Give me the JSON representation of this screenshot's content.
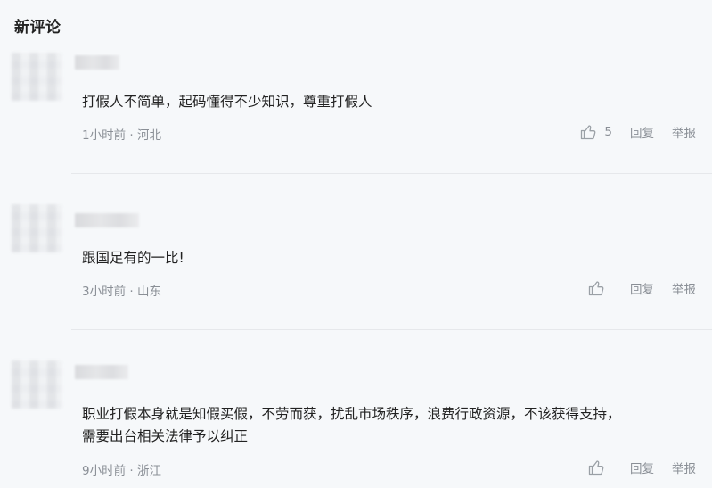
{
  "section": {
    "title": "新评论"
  },
  "comments": [
    {
      "content": "打假人不简单，起码懂得不少知识，尊重打假人",
      "content2": "",
      "time": "1小时前",
      "separator": "·",
      "location": "河北",
      "likes": "5",
      "reply_label": "回复",
      "report_label": "举报"
    },
    {
      "content": "跟国足有的一比!",
      "content2": "",
      "time": "3小时前",
      "separator": "·",
      "location": "山东",
      "likes": "",
      "reply_label": "回复",
      "report_label": "举报"
    },
    {
      "content": "职业打假本身就是知假买假，不劳而获，扰乱市场秩序，浪费行政资源，不该获得支持，",
      "content2": "需要出台相关法律予以纠正",
      "time": "9小时前",
      "separator": "·",
      "location": "浙江",
      "likes": "",
      "reply_label": "回复",
      "report_label": "举报"
    }
  ],
  "icons": {
    "like": "thumbs-up-icon"
  },
  "colors": {
    "meta": "#8a8f96",
    "text": "#222222",
    "background": "#f6f8fa"
  }
}
